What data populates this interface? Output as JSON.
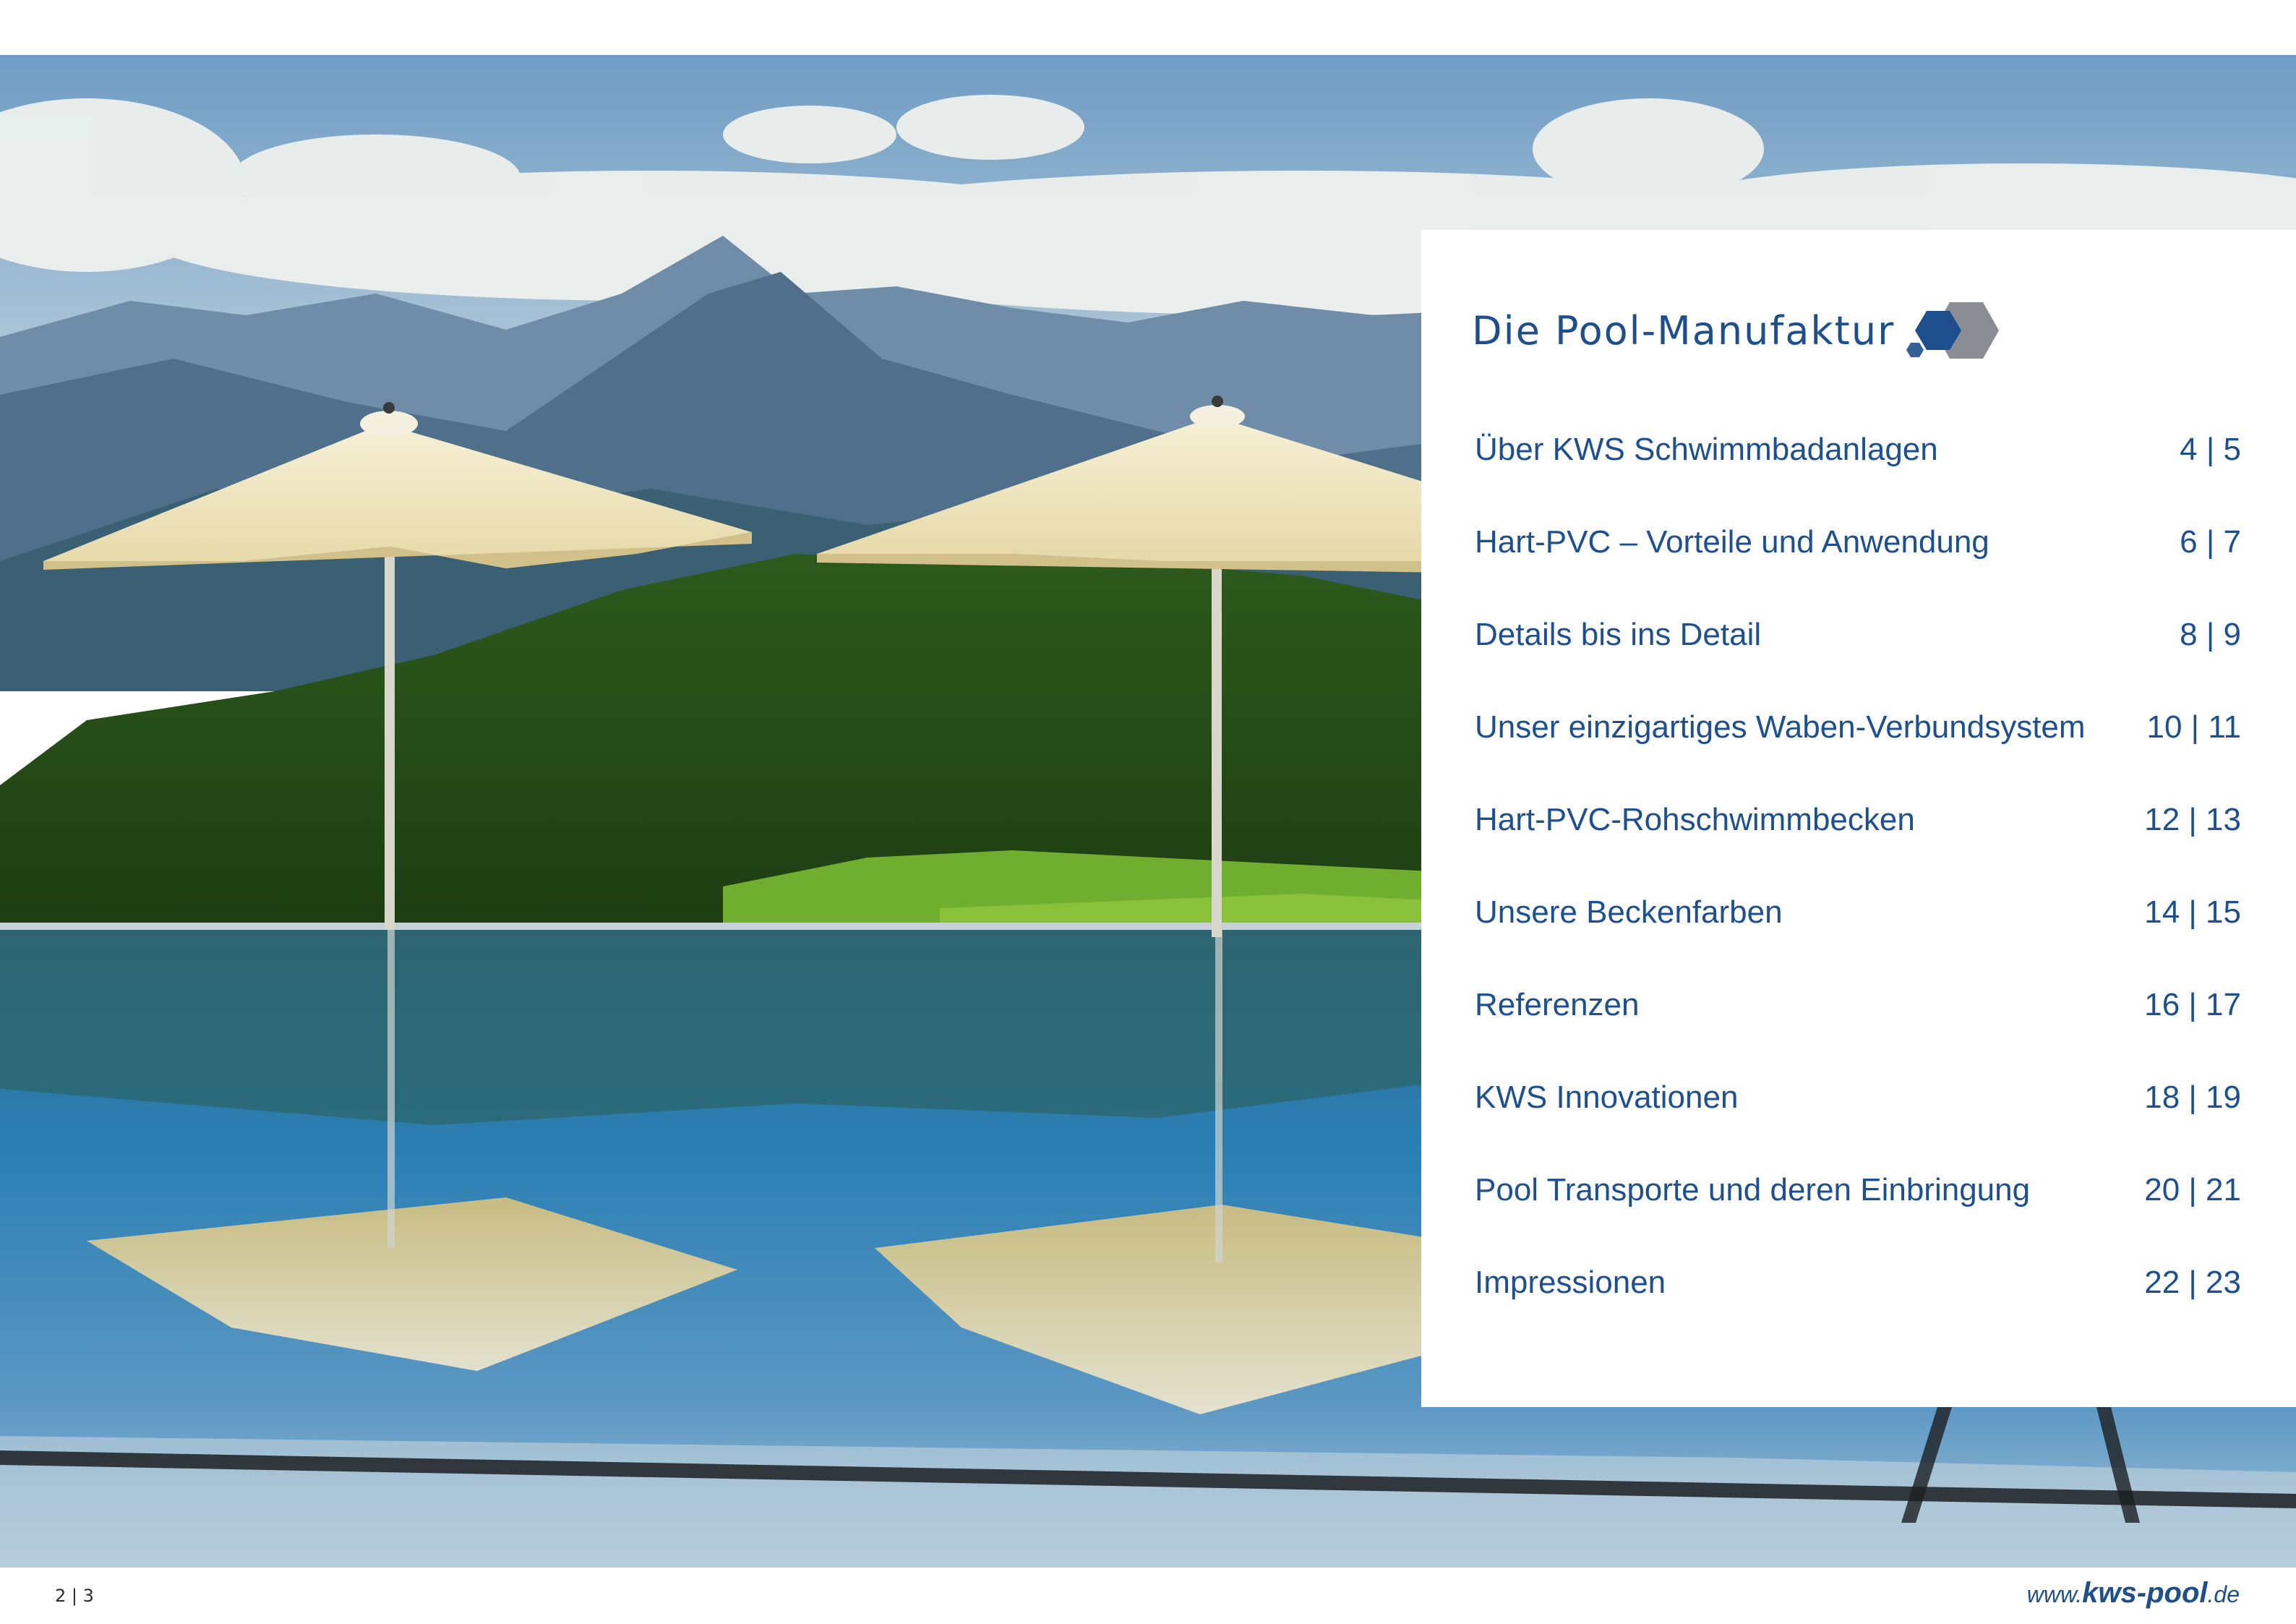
{
  "toc": {
    "title": "Die Pool-Manufaktur",
    "entries": [
      {
        "label": "Über KWS Schwimmbadanlagen",
        "pages": "4 | 5"
      },
      {
        "label": "Hart-PVC – Vorteile und Anwendung",
        "pages": "6 | 7"
      },
      {
        "label": "Details bis ins Detail",
        "pages": "8 | 9"
      },
      {
        "label": "Unser einzigartiges Waben-Verbundsystem",
        "pages": "10 | 11"
      },
      {
        "label": "Hart-PVC-Rohschwimmbecken",
        "pages": "12 | 13"
      },
      {
        "label": "Unsere Beckenfarben",
        "pages": "14 | 15"
      },
      {
        "label": "Referenzen",
        "pages": "16 | 17"
      },
      {
        "label": "KWS Innovationen",
        "pages": "18 | 19"
      },
      {
        "label": "Pool Transporte und deren Einbringung",
        "pages": "20 | 21"
      },
      {
        "label": "Impressionen",
        "pages": "22 | 23"
      }
    ]
  },
  "footer": {
    "page_number": "2 | 3",
    "url_prefix": "www.",
    "url_brand": "kws-pool",
    "url_suffix": ".de"
  },
  "colors": {
    "brand_blue": "#1f4e8c",
    "hex_dark": "#1f4e8c",
    "hex_gray": "#8a8d94"
  },
  "icons": {
    "logo": "hexagon-logo-icon"
  }
}
